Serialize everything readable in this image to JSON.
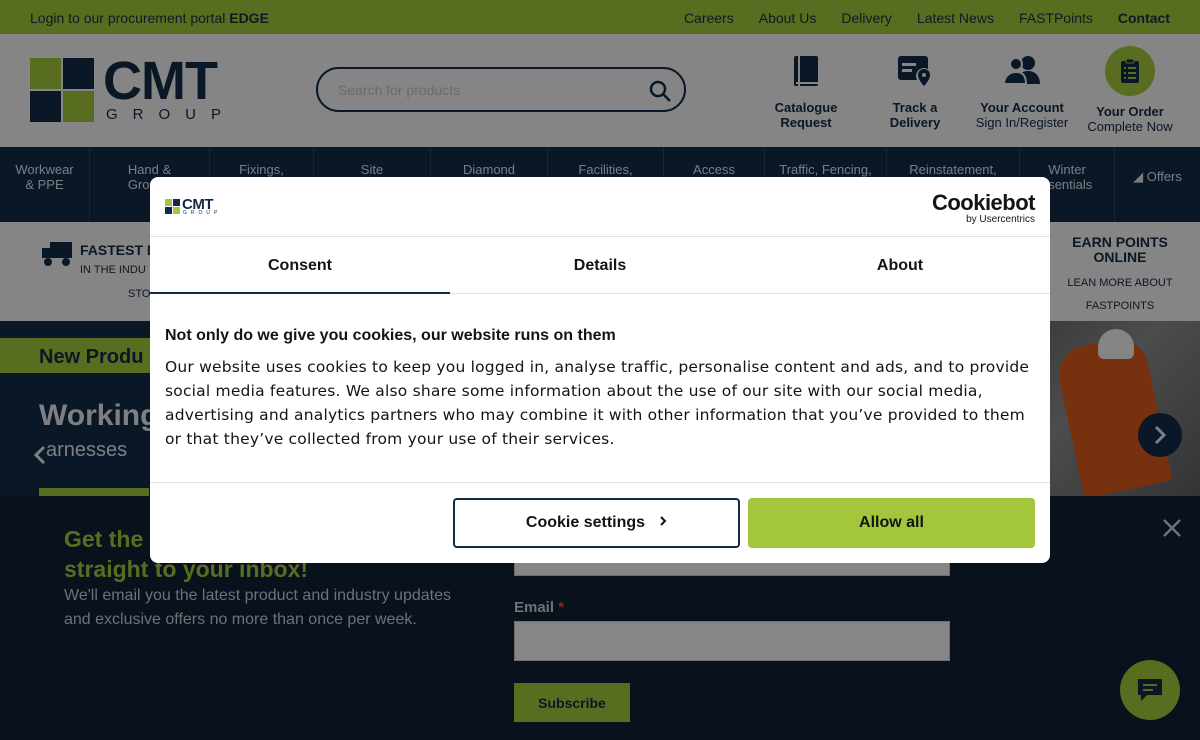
{
  "colors": {
    "brand_green": "#a3c63c",
    "brand_navy": "#132a46"
  },
  "topbar": {
    "login_text": "Login to our procurement portal ",
    "login_bold": "EDGE",
    "links": [
      "Careers",
      "About Us",
      "Delivery",
      "Latest News",
      "FASTPoints",
      "Contact"
    ]
  },
  "header": {
    "logo": {
      "word": "CMT",
      "sub": "GROUP"
    },
    "search": {
      "placeholder": "Search for products"
    },
    "icons": [
      {
        "icon": "book-icon",
        "l1": "Catalogue",
        "l2": "Request"
      },
      {
        "icon": "location-card-icon",
        "l1": "Track a",
        "l2": "Delivery"
      },
      {
        "icon": "users-icon",
        "l1": "Your Account",
        "l2": "Sign In/Register"
      },
      {
        "icon": "clipboard-icon",
        "l1": "Your Order",
        "l2": "Complete Now"
      }
    ]
  },
  "nav": {
    "items": [
      {
        "l1": "Workwear",
        "l2": "& PPE"
      },
      {
        "l1": "Hand &",
        "l2": "Ground"
      },
      {
        "l1": "Fixings,",
        "l2": ""
      },
      {
        "l1": "Site",
        "l2": ""
      },
      {
        "l1": "Diamond",
        "l2": ""
      },
      {
        "l1": "Facilities,",
        "l2": ""
      },
      {
        "l1": "Access",
        "l2": ""
      },
      {
        "l1": "Traffic, Fencing,",
        "l2": ""
      },
      {
        "l1": "Reinstatement,",
        "l2": ""
      },
      {
        "l1": "Winter",
        "l2": "ssentials"
      }
    ],
    "offers": "Offers"
  },
  "strip": {
    "left_title": "FASTEST D",
    "left_l2": "IN THE INDU",
    "left_l3": "STO",
    "right_title": "EARN POINTS",
    "right_title2": "ONLINE",
    "right_l2": "LEAN MORE ABOUT",
    "right_l3": "FASTPOINTS"
  },
  "hero": {
    "badge": "New Produ",
    "title": "Working",
    "sub": "arnesses"
  },
  "newsletter": {
    "heading_l1": "Get the",
    "heading_l2": "straight to your inbox!",
    "text": "We'll email you the latest product and industry updates and exclusive offers no more than once per week.",
    "email_label": "Email",
    "required": "*",
    "subscribe": "Subscribe"
  },
  "cookie": {
    "logo_word": "CMT",
    "logo_sub": "GROUP",
    "brand": "Cookiebot",
    "brand_by": "by Usercentrics",
    "tabs": [
      "Consent",
      "Details",
      "About"
    ],
    "heading": "Not only do we give you cookies, our website runs on them",
    "body": "Our website uses cookies to keep you logged in, analyse traffic, personalise content and ads, and to provide social media features. We also share some information about the use of our site with our social media, advertising and analytics partners who may combine it with other information that you’ve provided to them or that they’ve collected from your use of their services.",
    "settings_label": "Cookie settings",
    "allow_label": "Allow all"
  }
}
